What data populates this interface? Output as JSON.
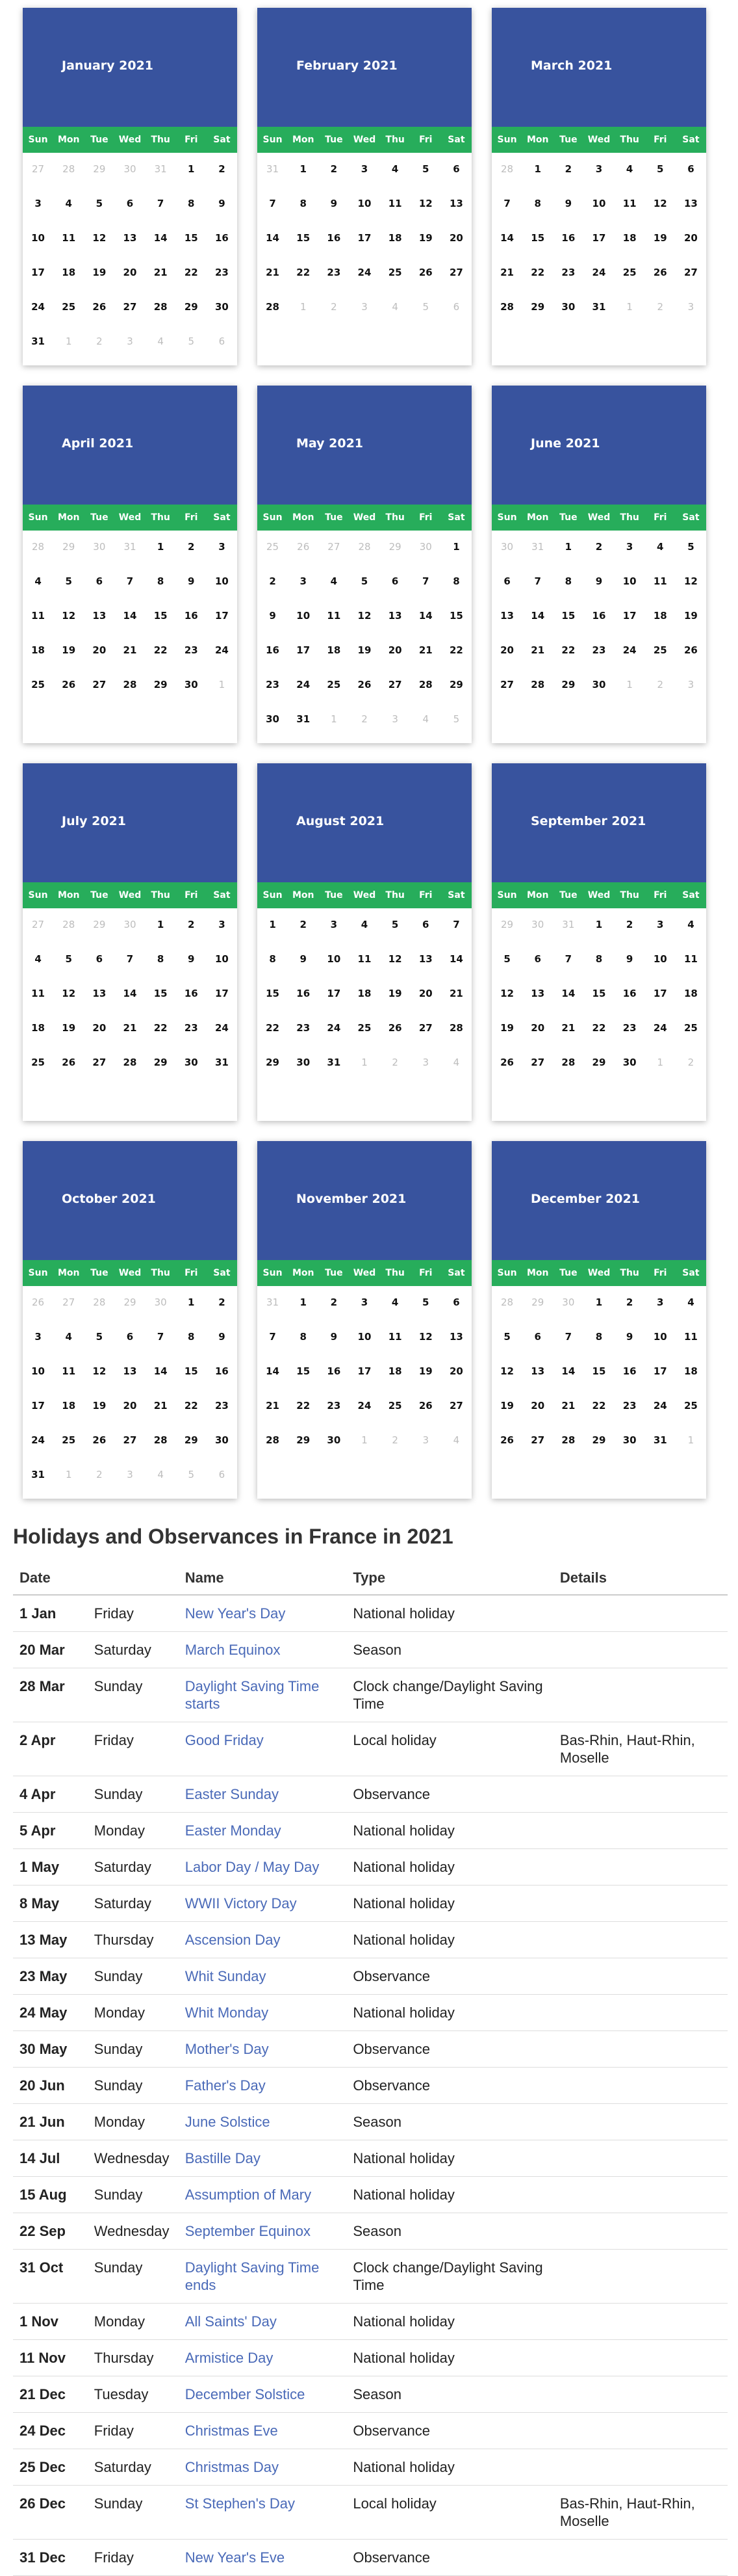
{
  "weekdays": [
    "Sun",
    "Mon",
    "Tue",
    "Wed",
    "Thu",
    "Fri",
    "Sat"
  ],
  "months": [
    {
      "title": "January 2021",
      "lead": 5,
      "days": 31,
      "prev_days": 31
    },
    {
      "title": "February 2021",
      "lead": 1,
      "days": 28,
      "prev_days": 31
    },
    {
      "title": "March 2021",
      "lead": 1,
      "days": 31,
      "prev_days": 28
    },
    {
      "title": "April 2021",
      "lead": 4,
      "days": 30,
      "prev_days": 31
    },
    {
      "title": "May 2021",
      "lead": 6,
      "days": 31,
      "prev_days": 30
    },
    {
      "title": "June 2021",
      "lead": 2,
      "days": 30,
      "prev_days": 31
    },
    {
      "title": "July 2021",
      "lead": 4,
      "days": 31,
      "prev_days": 30
    },
    {
      "title": "August 2021",
      "lead": 0,
      "days": 31,
      "prev_days": 31
    },
    {
      "title": "September 2021",
      "lead": 3,
      "days": 30,
      "prev_days": 31
    },
    {
      "title": "October 2021",
      "lead": 5,
      "days": 31,
      "prev_days": 30
    },
    {
      "title": "November 2021",
      "lead": 1,
      "days": 30,
      "prev_days": 31
    },
    {
      "title": "December 2021",
      "lead": 3,
      "days": 31,
      "prev_days": 30
    }
  ],
  "holidays": {
    "heading": "Holidays and Observances in France in 2021",
    "columns": [
      "Date",
      "",
      "Name",
      "Type",
      "Details"
    ],
    "rows": [
      {
        "date": "1 Jan",
        "weekday": "Friday",
        "name": "New Year's Day",
        "type": "National holiday",
        "details": ""
      },
      {
        "date": "20 Mar",
        "weekday": "Saturday",
        "name": "March Equinox",
        "type": "Season",
        "details": ""
      },
      {
        "date": "28 Mar",
        "weekday": "Sunday",
        "name": "Daylight Saving Time starts",
        "type": "Clock change/Daylight Saving Time",
        "details": ""
      },
      {
        "date": "2 Apr",
        "weekday": "Friday",
        "name": "Good Friday",
        "type": "Local holiday",
        "details": "Bas-Rhin, Haut-Rhin, Moselle"
      },
      {
        "date": "4 Apr",
        "weekday": "Sunday",
        "name": "Easter Sunday",
        "type": "Observance",
        "details": ""
      },
      {
        "date": "5 Apr",
        "weekday": "Monday",
        "name": "Easter Monday",
        "type": "National holiday",
        "details": ""
      },
      {
        "date": "1 May",
        "weekday": "Saturday",
        "name": "Labor Day / May Day",
        "type": "National holiday",
        "details": ""
      },
      {
        "date": "8 May",
        "weekday": "Saturday",
        "name": "WWII Victory Day",
        "type": "National holiday",
        "details": ""
      },
      {
        "date": "13 May",
        "weekday": "Thursday",
        "name": "Ascension Day",
        "type": "National holiday",
        "details": ""
      },
      {
        "date": "23 May",
        "weekday": "Sunday",
        "name": "Whit Sunday",
        "type": "Observance",
        "details": ""
      },
      {
        "date": "24 May",
        "weekday": "Monday",
        "name": "Whit Monday",
        "type": "National holiday",
        "details": ""
      },
      {
        "date": "30 May",
        "weekday": "Sunday",
        "name": "Mother's Day",
        "type": "Observance",
        "details": ""
      },
      {
        "date": "20 Jun",
        "weekday": "Sunday",
        "name": "Father's Day",
        "type": "Observance",
        "details": ""
      },
      {
        "date": "21 Jun",
        "weekday": "Monday",
        "name": "June Solstice",
        "type": "Season",
        "details": ""
      },
      {
        "date": "14 Jul",
        "weekday": "Wednesday",
        "name": "Bastille Day",
        "type": "National holiday",
        "details": ""
      },
      {
        "date": "15 Aug",
        "weekday": "Sunday",
        "name": "Assumption of Mary",
        "type": "National holiday",
        "details": ""
      },
      {
        "date": "22 Sep",
        "weekday": "Wednesday",
        "name": "September Equinox",
        "type": "Season",
        "details": ""
      },
      {
        "date": "31 Oct",
        "weekday": "Sunday",
        "name": "Daylight Saving Time ends",
        "type": "Clock change/Daylight Saving Time",
        "details": ""
      },
      {
        "date": "1 Nov",
        "weekday": "Monday",
        "name": "All Saints' Day",
        "type": "National holiday",
        "details": ""
      },
      {
        "date": "11 Nov",
        "weekday": "Thursday",
        "name": "Armistice Day",
        "type": "National holiday",
        "details": ""
      },
      {
        "date": "21 Dec",
        "weekday": "Tuesday",
        "name": "December Solstice",
        "type": "Season",
        "details": ""
      },
      {
        "date": "24 Dec",
        "weekday": "Friday",
        "name": "Christmas Eve",
        "type": "Observance",
        "details": ""
      },
      {
        "date": "25 Dec",
        "weekday": "Saturday",
        "name": "Christmas Day",
        "type": "National holiday",
        "details": ""
      },
      {
        "date": "26 Dec",
        "weekday": "Sunday",
        "name": "St Stephen's Day",
        "type": "Local holiday",
        "details": "Bas-Rhin, Haut-Rhin, Moselle"
      },
      {
        "date": "31 Dec",
        "weekday": "Friday",
        "name": "New Year's Eve",
        "type": "Observance",
        "details": ""
      }
    ]
  },
  "colors": {
    "header_blue": "#38539e",
    "weekday_green": "#27ad5b",
    "link_blue": "#4a6ab8",
    "other_month_day": "#bdbdbd"
  }
}
